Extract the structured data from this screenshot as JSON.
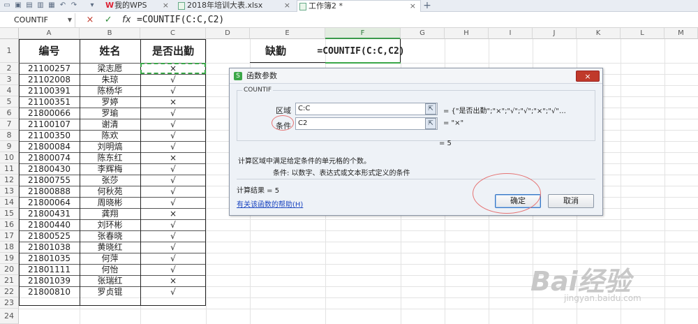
{
  "tabs": {
    "wps_label": "我的WPS",
    "file_label": "2018年培训大表.xlsx",
    "active_label": "工作簿2 *"
  },
  "formula_bar": {
    "name_box": "COUNTIF",
    "cancel_glyph": "×",
    "enter_glyph": "✓",
    "fx_glyph": "fx",
    "formula": "=COUNTIF(C:C,C2)"
  },
  "columns": [
    "A",
    "B",
    "C",
    "D",
    "E",
    "F",
    "G",
    "H",
    "I",
    "J",
    "K",
    "L",
    "M"
  ],
  "rows": [
    "1",
    "2",
    "3",
    "4",
    "5",
    "6",
    "7",
    "8",
    "9",
    "10",
    "11",
    "12",
    "13",
    "14",
    "15",
    "16",
    "17",
    "18",
    "19",
    "20",
    "21",
    "22",
    "23",
    "24"
  ],
  "sheet": {
    "headers": [
      "编号",
      "姓名",
      "是否出勤"
    ],
    "e1": "缺勤",
    "f1": "=COUNTIF(C:C,C2)",
    "records": [
      [
        "21100257",
        "梁志愿",
        "×"
      ],
      [
        "21102008",
        "朱琼",
        "√"
      ],
      [
        "21100391",
        "陈杨华",
        "√"
      ],
      [
        "21100351",
        "罗婷",
        "×"
      ],
      [
        "21800066",
        "罗瑜",
        "√"
      ],
      [
        "21100107",
        "谢清",
        "√"
      ],
      [
        "21100350",
        "陈欢",
        "√"
      ],
      [
        "21800084",
        "刘明熇",
        "√"
      ],
      [
        "21800074",
        "陈东红",
        "×"
      ],
      [
        "21800430",
        "李辉梅",
        "√"
      ],
      [
        "21800755",
        "张莎",
        "√"
      ],
      [
        "21800888",
        "何秋苑",
        "√"
      ],
      [
        "21800064",
        "周晓彬",
        "√"
      ],
      [
        "21800431",
        "龚翔",
        "×"
      ],
      [
        "21800440",
        "刘环彬",
        "√"
      ],
      [
        "21800525",
        "张春晓",
        "√"
      ],
      [
        "21801038",
        "黄晓红",
        "√"
      ],
      [
        "21801035",
        "何萍",
        "√"
      ],
      [
        "21801111",
        "何怡",
        "√"
      ],
      [
        "21801039",
        "张瑞红",
        "×"
      ],
      [
        "21800810",
        "罗贞锟",
        "√"
      ]
    ]
  },
  "dialog": {
    "title": "函数参数",
    "close_glyph": "×",
    "function_name": "COUNTIF",
    "range_label": "区域",
    "range_value": "C:C",
    "range_result": "= {\"是否出勤\";\"×\";\"√\";\"√\";\"×\";\"√\"…",
    "criteria_label": "条件",
    "criteria_value": "C2",
    "criteria_result": "= \"×\"",
    "formula_result": "= 5",
    "description": "计算区域中满足给定条件的单元格的个数。",
    "criteria_help": "条件:  以数字、表达式或文本形式定义的条件",
    "calc_result": "计算结果 = 5",
    "help_link": "有关该函数的帮助(H)",
    "ok_label": "确定",
    "cancel_label": "取消"
  },
  "watermark": {
    "brand": "Bai经验",
    "url": "jingyan.baidu.com"
  },
  "colors": {
    "selection": "#3aa648",
    "close_button": "#c0392b",
    "annotation_circle": "#e57373",
    "link": "#1a45c0"
  }
}
